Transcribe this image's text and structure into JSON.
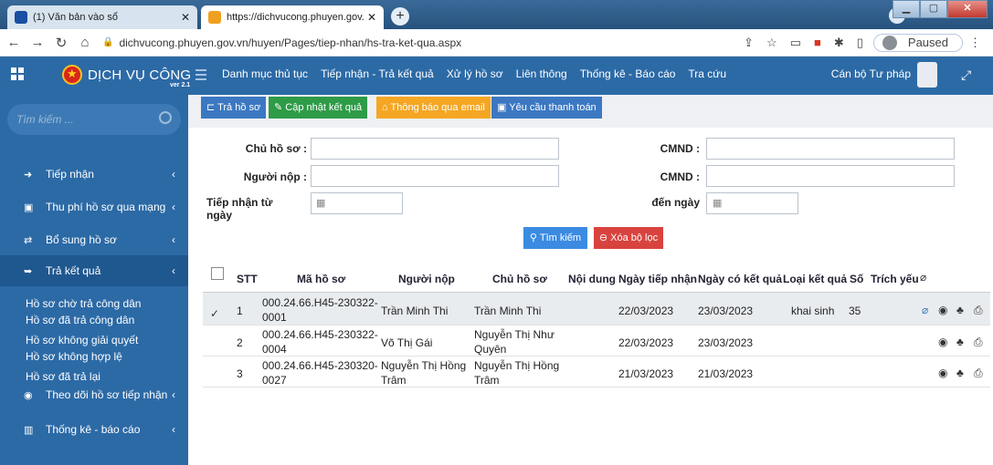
{
  "browser": {
    "tab1_title": "(1) Văn bản vào sổ",
    "tab2_title": "https://dichvucong.phuyen.gov.vn",
    "url": "dichvucong.phuyen.gov.vn/huyen/Pages/tiep-nhan/hs-tra-ket-qua.aspx",
    "paused_label": "Paused"
  },
  "header": {
    "brand": "DỊCH VỤ CÔNG",
    "version": "ver 2.1",
    "nav": [
      "Danh mục thủ tục",
      "Tiếp nhận - Trả kết quả",
      "Xử lý hồ sơ",
      "Liên thông",
      "Thống kê - Báo cáo",
      "Tra cứu"
    ],
    "user": "Cán bộ Tư pháp"
  },
  "sidebar": {
    "search_placeholder": "Tìm kiếm ...",
    "items": [
      {
        "label": "Tiếp nhận"
      },
      {
        "label": "Thu phí hồ sơ qua mạng"
      },
      {
        "label": "Bổ sung hồ sơ"
      },
      {
        "label": "Trả kết quả"
      },
      {
        "label": "Theo dõi hồ sơ tiếp nhận"
      },
      {
        "label": "Thống kê - báo cáo"
      }
    ],
    "subitems": [
      "Hồ sơ chờ trả công dân",
      "Hồ sơ đã trả công dân",
      "Hồ sơ không giải quyết",
      "Hồ sơ không hợp lệ",
      "Hồ sơ đã trả lại"
    ]
  },
  "toolbar": {
    "return": "Trả hồ sơ",
    "update": "Cập nhật kết quả",
    "email": "Thông báo qua email",
    "payment": "Yêu cầu thanh toán"
  },
  "form": {
    "owner_label": "Chủ hồ sơ :",
    "submitter_label": "Người nộp :",
    "from_label": "Tiếp nhận từ ngày",
    "to_label": "đến ngày",
    "id1_label": "CMND :",
    "id2_label": "CMND :",
    "search_btn": "Tìm kiếm",
    "clear_btn": "Xóa bộ lọc"
  },
  "table": {
    "headers": [
      "STT",
      "Mã hồ sơ",
      "Người nộp",
      "Chủ hồ sơ",
      "Nội dung",
      "Ngày tiếp nhận",
      "Ngày có kết quả",
      "Loại kết quả",
      "Số",
      "Trích yếu"
    ],
    "rows": [
      {
        "stt": "1",
        "ma1": "000.24.66.H45-230322-",
        "ma2": "0001",
        "nguoi_nop": "Trần Minh Thi",
        "nguoi_nop2": "",
        "chu": "Trần Minh Thi",
        "chu2": "",
        "ngay_tn": "22/03/2023",
        "ngay_kq": "23/03/2023",
        "loai": "khai sinh",
        "so": "35"
      },
      {
        "stt": "2",
        "ma1": "000.24.66.H45-230322-",
        "ma2": "0004",
        "nguoi_nop": "Võ Thị Gái",
        "nguoi_nop2": "",
        "chu": "Nguyễn Thị Như",
        "chu2": "Quyên",
        "ngay_tn": "22/03/2023",
        "ngay_kq": "23/03/2023",
        "loai": "",
        "so": ""
      },
      {
        "stt": "3",
        "ma1": "000.24.66.H45-230320-",
        "ma2": "0027",
        "nguoi_nop": "Nguyễn Thị Hồng",
        "nguoi_nop2": "Trâm",
        "chu": "Nguyễn Thị Hồng",
        "chu2": "Trâm",
        "ngay_tn": "21/03/2023",
        "ngay_kq": "21/03/2023",
        "loai": "",
        "so": ""
      }
    ]
  }
}
